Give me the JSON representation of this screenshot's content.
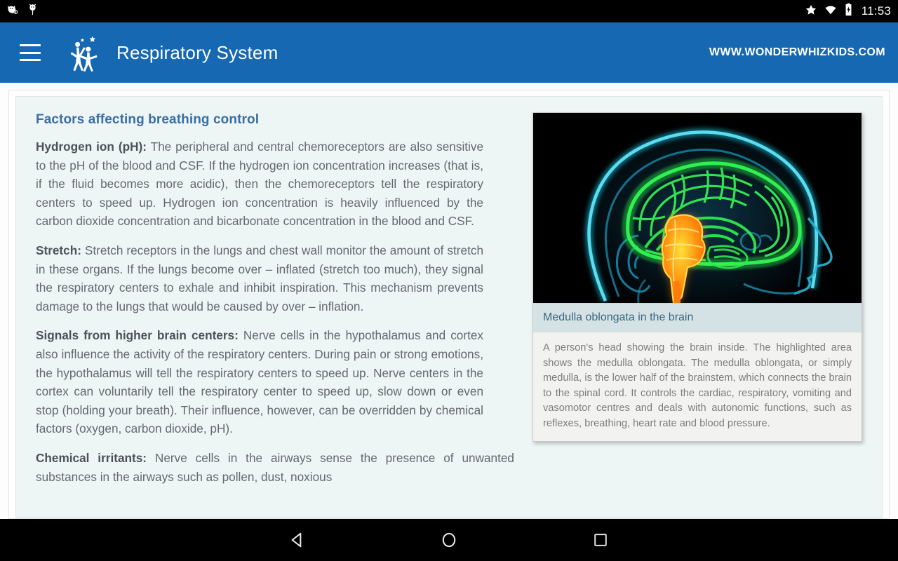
{
  "statusbar": {
    "time": "11:53",
    "left_icons": [
      "cat-notification-icon",
      "balloon-notification-icon"
    ],
    "right_icons": [
      "star-icon",
      "wifi-icon",
      "battery-charging-icon"
    ]
  },
  "appbar": {
    "menu_icon": "hamburger-menu-icon",
    "logo_icon": "wonderwhizkids-logo-icon",
    "title": "Respiratory System",
    "url": "WWW.WONDERWHIZKIDS.COM",
    "background_color": "#1668b3"
  },
  "content": {
    "section_title": "Factors affecting breathing control",
    "title_color": "#3a6ea5",
    "paragraphs": [
      {
        "lead": "Hydrogen ion (pH):",
        "text": " The peripheral and central chemoreceptors are also sensitive to the pH of the blood and CSF. If the hydrogen ion concentration increases (that is, if the fluid becomes more acidic), then the chemoreceptors tell the respiratory centers to speed up. Hydrogen ion concentration is heavily influenced by the carbon dioxide concentration and bicarbonate concentration in the blood and CSF."
      },
      {
        "lead": "Stretch:",
        "text": " Stretch receptors in the lungs and chest wall monitor the amount of stretch in these organs. If the lungs become over – inflated (stretch too much), they signal the respiratory centers to exhale and inhibit inspiration. This mechanism prevents damage to the lungs that would be caused by over – inflation."
      },
      {
        "lead": "Signals from higher brain centers:",
        "text": " Nerve cells in the hypothalamus and cortex also influence the activity of the respiratory centers. During pain or strong emotions, the hypothalamus will tell the respiratory centers to speed up. Nerve centers in the cortex can voluntarily tell the respiratory center to speed up, slow down or even stop (holding your breath). Their influence, however, can be overridden by chemical factors (oxygen, carbon dioxide, pH)."
      },
      {
        "lead": "Chemical irritants:",
        "text": " Nerve cells in the airways sense the presence of unwanted substances in the airways such as pollen, dust, noxious"
      }
    ]
  },
  "figure": {
    "image_alt": "brain-medulla-oblongata-illustration",
    "caption": "Medulla oblongata in the brain",
    "description": "A person's head showing the brain inside. The highlighted area shows the medulla oblongata. The medulla oblongata, or simply medulla, is the lower half of the brainstem, which connects the brain to the spinal cord. It controls the cardiac, respiratory, vomiting and vasomotor centres and deals with autonomic functions, such as reflexes, breathing, heart rate and blood pressure.",
    "caption_bg": "#d4e2e6",
    "image_colors": {
      "background": "#000000",
      "head_outline": "#1ec8e6",
      "brain": "#27d642",
      "medulla": "#ff8c14"
    }
  },
  "navbar": {
    "back": "back-triangle-icon",
    "home": "home-circle-icon",
    "recents": "recents-square-icon"
  }
}
